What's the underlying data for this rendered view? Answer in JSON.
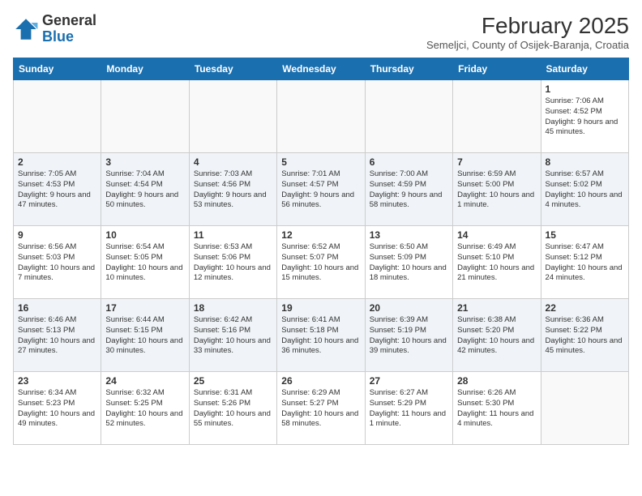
{
  "header": {
    "logo_general": "General",
    "logo_blue": "Blue",
    "month": "February 2025",
    "location": "Semeljci, County of Osijek-Baranja, Croatia"
  },
  "weekdays": [
    "Sunday",
    "Monday",
    "Tuesday",
    "Wednesday",
    "Thursday",
    "Friday",
    "Saturday"
  ],
  "weeks": [
    [
      {
        "day": "",
        "info": ""
      },
      {
        "day": "",
        "info": ""
      },
      {
        "day": "",
        "info": ""
      },
      {
        "day": "",
        "info": ""
      },
      {
        "day": "",
        "info": ""
      },
      {
        "day": "",
        "info": ""
      },
      {
        "day": "1",
        "info": "Sunrise: 7:06 AM\nSunset: 4:52 PM\nDaylight: 9 hours and 45 minutes."
      }
    ],
    [
      {
        "day": "2",
        "info": "Sunrise: 7:05 AM\nSunset: 4:53 PM\nDaylight: 9 hours and 47 minutes."
      },
      {
        "day": "3",
        "info": "Sunrise: 7:04 AM\nSunset: 4:54 PM\nDaylight: 9 hours and 50 minutes."
      },
      {
        "day": "4",
        "info": "Sunrise: 7:03 AM\nSunset: 4:56 PM\nDaylight: 9 hours and 53 minutes."
      },
      {
        "day": "5",
        "info": "Sunrise: 7:01 AM\nSunset: 4:57 PM\nDaylight: 9 hours and 56 minutes."
      },
      {
        "day": "6",
        "info": "Sunrise: 7:00 AM\nSunset: 4:59 PM\nDaylight: 9 hours and 58 minutes."
      },
      {
        "day": "7",
        "info": "Sunrise: 6:59 AM\nSunset: 5:00 PM\nDaylight: 10 hours and 1 minute."
      },
      {
        "day": "8",
        "info": "Sunrise: 6:57 AM\nSunset: 5:02 PM\nDaylight: 10 hours and 4 minutes."
      }
    ],
    [
      {
        "day": "9",
        "info": "Sunrise: 6:56 AM\nSunset: 5:03 PM\nDaylight: 10 hours and 7 minutes."
      },
      {
        "day": "10",
        "info": "Sunrise: 6:54 AM\nSunset: 5:05 PM\nDaylight: 10 hours and 10 minutes."
      },
      {
        "day": "11",
        "info": "Sunrise: 6:53 AM\nSunset: 5:06 PM\nDaylight: 10 hours and 12 minutes."
      },
      {
        "day": "12",
        "info": "Sunrise: 6:52 AM\nSunset: 5:07 PM\nDaylight: 10 hours and 15 minutes."
      },
      {
        "day": "13",
        "info": "Sunrise: 6:50 AM\nSunset: 5:09 PM\nDaylight: 10 hours and 18 minutes."
      },
      {
        "day": "14",
        "info": "Sunrise: 6:49 AM\nSunset: 5:10 PM\nDaylight: 10 hours and 21 minutes."
      },
      {
        "day": "15",
        "info": "Sunrise: 6:47 AM\nSunset: 5:12 PM\nDaylight: 10 hours and 24 minutes."
      }
    ],
    [
      {
        "day": "16",
        "info": "Sunrise: 6:46 AM\nSunset: 5:13 PM\nDaylight: 10 hours and 27 minutes."
      },
      {
        "day": "17",
        "info": "Sunrise: 6:44 AM\nSunset: 5:15 PM\nDaylight: 10 hours and 30 minutes."
      },
      {
        "day": "18",
        "info": "Sunrise: 6:42 AM\nSunset: 5:16 PM\nDaylight: 10 hours and 33 minutes."
      },
      {
        "day": "19",
        "info": "Sunrise: 6:41 AM\nSunset: 5:18 PM\nDaylight: 10 hours and 36 minutes."
      },
      {
        "day": "20",
        "info": "Sunrise: 6:39 AM\nSunset: 5:19 PM\nDaylight: 10 hours and 39 minutes."
      },
      {
        "day": "21",
        "info": "Sunrise: 6:38 AM\nSunset: 5:20 PM\nDaylight: 10 hours and 42 minutes."
      },
      {
        "day": "22",
        "info": "Sunrise: 6:36 AM\nSunset: 5:22 PM\nDaylight: 10 hours and 45 minutes."
      }
    ],
    [
      {
        "day": "23",
        "info": "Sunrise: 6:34 AM\nSunset: 5:23 PM\nDaylight: 10 hours and 49 minutes."
      },
      {
        "day": "24",
        "info": "Sunrise: 6:32 AM\nSunset: 5:25 PM\nDaylight: 10 hours and 52 minutes."
      },
      {
        "day": "25",
        "info": "Sunrise: 6:31 AM\nSunset: 5:26 PM\nDaylight: 10 hours and 55 minutes."
      },
      {
        "day": "26",
        "info": "Sunrise: 6:29 AM\nSunset: 5:27 PM\nDaylight: 10 hours and 58 minutes."
      },
      {
        "day": "27",
        "info": "Sunrise: 6:27 AM\nSunset: 5:29 PM\nDaylight: 11 hours and 1 minute."
      },
      {
        "day": "28",
        "info": "Sunrise: 6:26 AM\nSunset: 5:30 PM\nDaylight: 11 hours and 4 minutes."
      },
      {
        "day": "",
        "info": ""
      }
    ]
  ]
}
